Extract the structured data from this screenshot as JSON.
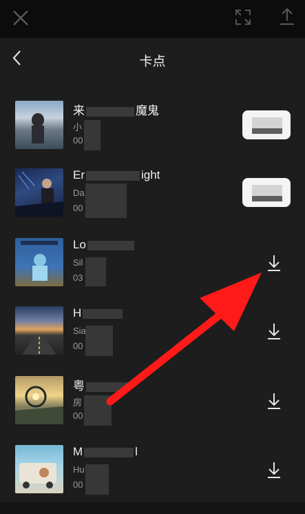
{
  "header": {
    "title": "卡点"
  },
  "songs": [
    {
      "name": "来",
      "name_tail": "魔鬼",
      "artist": "小",
      "duration": "00",
      "action": "preview-pill"
    },
    {
      "name": "Er",
      "name_tail": "ight",
      "artist": "Da",
      "duration": "00",
      "action": "preview-pill"
    },
    {
      "name": "Lo",
      "name_tail": "",
      "artist": "Sil",
      "duration": "03",
      "action": "download"
    },
    {
      "name": "H",
      "name_tail": "",
      "artist": "Sia",
      "duration": "00",
      "action": "download"
    },
    {
      "name": "粤",
      "name_tail": "",
      "artist": "房",
      "duration": "00",
      "action": "download"
    },
    {
      "name": "M",
      "name_tail": "l",
      "artist": "Hu",
      "duration": "00",
      "action": "download"
    }
  ],
  "colors": {
    "annotation_arrow": "#ff1a1a",
    "background": "#1d1d1d",
    "topbar": "#0c0c0c"
  }
}
